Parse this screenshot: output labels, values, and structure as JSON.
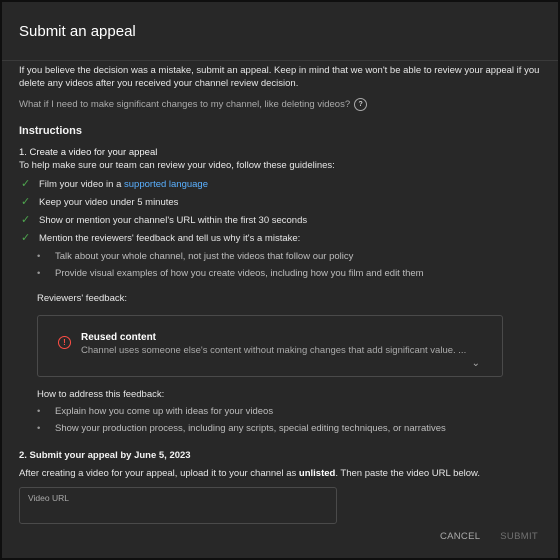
{
  "dialog": {
    "title": "Submit an appeal",
    "intro": "If you believe the decision was a mistake, submit an appeal. Keep in mind that we won't be able to review your appeal if you delete any videos after you received your channel review decision.",
    "faq": "What if I need to make significant changes to my channel, like deleting videos?",
    "instructions_heading": "Instructions",
    "step1": {
      "title": "1. Create a video for your appeal",
      "subtitle": "To help make sure our team can review your video, follow these guidelines:",
      "checks": [
        {
          "text": "Film your video in a ",
          "link": "supported language"
        },
        {
          "text": "Keep your video under 5 minutes"
        },
        {
          "text": "Show or mention your channel's URL within the first 30 seconds"
        },
        {
          "text": "Mention the reviewers' feedback and tell us why it's a mistake:"
        }
      ],
      "mention_bullets": [
        "Talk about your whole channel, not just the videos that follow our policy",
        "Provide visual examples of how you create videos, including how you film and edit them"
      ],
      "reviewers_label": "Reviewers' feedback:",
      "feedback": {
        "title": "Reused content",
        "text": "Channel uses someone else's content without making changes that add significant value. ..."
      },
      "how_label": "How to address this feedback:",
      "how_bullets": [
        "Explain how you come up with ideas for your videos",
        "Show your production process, including any scripts, special editing techniques, or narratives"
      ]
    },
    "step2": {
      "title": "2. Submit your appeal by June 5, 2023",
      "text_before": "After creating a video for your appeal, upload it to your channel as ",
      "text_bold": "unlisted",
      "text_after": ". Then paste the video URL below."
    },
    "url_placeholder": "Video URL",
    "cancel_label": "CANCEL",
    "submit_label": "SUBMIT"
  },
  "colors": {
    "background": "#282828",
    "check": "#4ea54e",
    "link": "#5ab0ff",
    "error": "#ff4e45"
  }
}
